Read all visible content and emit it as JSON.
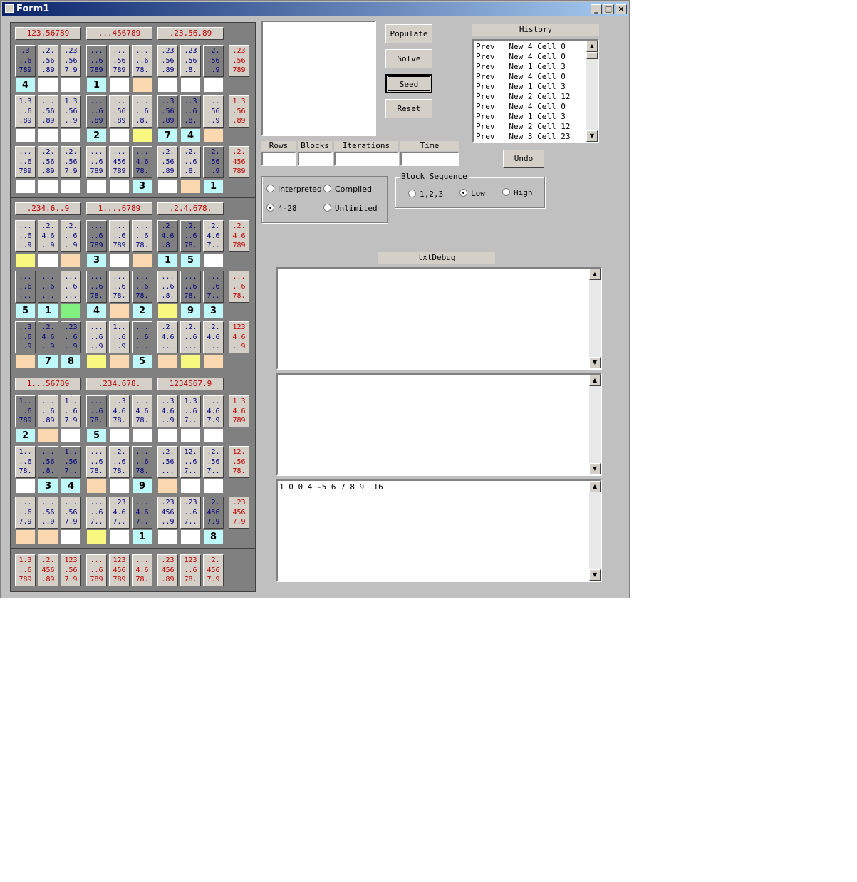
{
  "window": {
    "title": "Form1",
    "minimize": "_",
    "maximize": "□",
    "close": "×"
  },
  "blocks": [
    {
      "label": "123.56789"
    },
    {
      "label": "...456789"
    },
    {
      "label": ".23.56.89"
    },
    {
      "label": ".234.6..9"
    },
    {
      "label": "1....6789"
    },
    {
      "label": ".2.4.678."
    },
    {
      "label": "1...56789"
    },
    {
      "label": ".234.678."
    },
    {
      "label": "1234567.9"
    }
  ],
  "rows": [
    {
      "cands": [
        [
          ".3",
          "..6",
          "789"
        ],
        [
          ".2.",
          ".56",
          ".89"
        ],
        [
          ".23",
          ".56",
          "7.9"
        ],
        [
          "...",
          "..6",
          "789"
        ],
        [
          "...",
          ".56",
          "789"
        ],
        [
          "...",
          "..6",
          "78."
        ],
        [
          ".23",
          ".56",
          ".89"
        ],
        [
          ".23",
          ".56",
          ".8."
        ],
        [
          ".2.",
          ".56",
          "..9"
        ]
      ],
      "dark": [
        1,
        0,
        0,
        1,
        0,
        0,
        0,
        0,
        1
      ],
      "cells": [
        [
          "4",
          "c"
        ],
        [
          "",
          ""
        ],
        [
          "",
          ""
        ],
        [
          "1",
          "c"
        ],
        [
          "",
          ""
        ],
        [
          "",
          "o"
        ],
        [
          "",
          ""
        ],
        [
          "",
          ""
        ],
        [
          "",
          ""
        ]
      ],
      "side": [
        ".23",
        ".56",
        "789"
      ]
    },
    {
      "cands": [
        [
          "1.3",
          "..6",
          ".89"
        ],
        [
          "...",
          ".56",
          ".89"
        ],
        [
          "1.3",
          ".56",
          "..9"
        ],
        [
          "...",
          "..6",
          ".89"
        ],
        [
          "...",
          ".56",
          ".89"
        ],
        [
          "...",
          "..6",
          ".8."
        ],
        [
          "..3",
          ".56",
          ".89"
        ],
        [
          "..3",
          "..6",
          ".8."
        ],
        [
          "...",
          ".56",
          "..9"
        ]
      ],
      "dark": [
        0,
        0,
        0,
        1,
        0,
        0,
        1,
        1,
        0
      ],
      "cells": [
        [
          "",
          ""
        ],
        [
          "",
          ""
        ],
        [
          "",
          ""
        ],
        [
          "2",
          "c"
        ],
        [
          "",
          ""
        ],
        [
          "",
          "y"
        ],
        [
          "7",
          "c"
        ],
        [
          "4",
          "c"
        ],
        [
          "",
          "o"
        ]
      ],
      "side": [
        "1.3",
        ".56",
        ".89"
      ]
    },
    {
      "cands": [
        [
          "...",
          "..6",
          "789"
        ],
        [
          ".2.",
          ".56",
          ".89"
        ],
        [
          ".2.",
          ".56",
          "7.9"
        ],
        [
          "...",
          "..6",
          "789"
        ],
        [
          "...",
          "456",
          "789"
        ],
        [
          "...",
          "4.6",
          "78."
        ],
        [
          ".2.",
          ".56",
          ".89"
        ],
        [
          ".2.",
          "..6",
          ".8."
        ],
        [
          ".2.",
          ".56",
          "..9"
        ]
      ],
      "dark": [
        0,
        0,
        0,
        0,
        0,
        1,
        0,
        0,
        1
      ],
      "cells": [
        [
          "",
          ""
        ],
        [
          "",
          ""
        ],
        [
          "",
          ""
        ],
        [
          "",
          ""
        ],
        [
          "",
          ""
        ],
        [
          "3",
          "c"
        ],
        [
          "",
          ""
        ],
        [
          "",
          "o"
        ],
        [
          "1",
          "c"
        ]
      ],
      "side": [
        ".2.",
        "456",
        "789"
      ]
    },
    {
      "cands": [
        [
          "...",
          "..6",
          "..9"
        ],
        [
          ".2.",
          "4.6",
          "..9"
        ],
        [
          ".2.",
          "..6",
          "..9"
        ],
        [
          "...",
          "..6",
          "789"
        ],
        [
          "...",
          "..6",
          "789"
        ],
        [
          "...",
          "..6",
          "78."
        ],
        [
          ".2.",
          "4.6",
          ".8."
        ],
        [
          ".2.",
          "..6",
          "78."
        ],
        [
          ".2.",
          "4.6",
          "7.."
        ]
      ],
      "dark": [
        0,
        0,
        0,
        1,
        0,
        0,
        1,
        1,
        0
      ],
      "cells": [
        [
          "",
          "y"
        ],
        [
          "",
          ""
        ],
        [
          "",
          "o"
        ],
        [
          "3",
          "c"
        ],
        [
          "",
          ""
        ],
        [
          "",
          "o"
        ],
        [
          "1",
          "c"
        ],
        [
          "5",
          "c"
        ],
        [
          "",
          ""
        ]
      ],
      "side": [
        ".2.",
        "4.6",
        "789"
      ]
    },
    {
      "cands": [
        [
          "...",
          "..6",
          "..."
        ],
        [
          "...",
          "..6",
          "..."
        ],
        [
          "...",
          "..6",
          "..."
        ],
        [
          "...",
          "..6",
          "78."
        ],
        [
          "...",
          "..6",
          "78."
        ],
        [
          "...",
          "..6",
          "78."
        ],
        [
          "...",
          "..6",
          ".8."
        ],
        [
          "...",
          "..6",
          "78."
        ],
        [
          "...",
          "..6",
          "7.."
        ]
      ],
      "dark": [
        1,
        1,
        0,
        1,
        0,
        1,
        0,
        1,
        1
      ],
      "cells": [
        [
          "5",
          "c"
        ],
        [
          "1",
          "c"
        ],
        [
          "",
          "g"
        ],
        [
          "4",
          "c"
        ],
        [
          "",
          "o"
        ],
        [
          "2",
          "c"
        ],
        [
          "",
          "y"
        ],
        [
          "9",
          "c"
        ],
        [
          "3",
          "c"
        ]
      ],
      "side": [
        "...",
        "..6",
        "78."
      ]
    },
    {
      "cands": [
        [
          "..3",
          "..6",
          "..9"
        ],
        [
          ".2.",
          "4.6",
          "..9"
        ],
        [
          ".23",
          "..6",
          "..9"
        ],
        [
          "...",
          "..6",
          "..9"
        ],
        [
          "1..",
          "..6",
          "..9"
        ],
        [
          "...",
          "..6",
          "..."
        ],
        [
          ".2.",
          "4.6",
          "..."
        ],
        [
          ".2.",
          "..6",
          "..."
        ],
        [
          ".2.",
          "4.6",
          "..."
        ]
      ],
      "dark": [
        1,
        1,
        1,
        0,
        0,
        1,
        0,
        0,
        0
      ],
      "cells": [
        [
          "",
          "o"
        ],
        [
          "7",
          "c"
        ],
        [
          "8",
          "c"
        ],
        [
          "",
          "y"
        ],
        [
          "",
          "o"
        ],
        [
          "5",
          "c"
        ],
        [
          "",
          "o"
        ],
        [
          "",
          "y"
        ],
        [
          "",
          "o"
        ]
      ],
      "side": [
        "123",
        "4.6",
        "..9"
      ]
    },
    {
      "cands": [
        [
          "1..",
          "..6",
          "789"
        ],
        [
          "...",
          "..6",
          ".89"
        ],
        [
          "1..",
          "..6",
          "7.9"
        ],
        [
          "...",
          "..6",
          "78."
        ],
        [
          "..3",
          "4.6",
          "78."
        ],
        [
          "...",
          "4.6",
          "78."
        ],
        [
          "..3",
          "4.6",
          "..9"
        ],
        [
          "1.3",
          "..6",
          "7.."
        ],
        [
          "...",
          "4.6",
          "7.9"
        ]
      ],
      "dark": [
        1,
        0,
        0,
        1,
        0,
        0,
        0,
        0,
        0
      ],
      "cells": [
        [
          "2",
          "c"
        ],
        [
          "",
          "o"
        ],
        [
          "",
          ""
        ],
        [
          "5",
          "c"
        ],
        [
          "",
          ""
        ],
        [
          "",
          ""
        ],
        [
          "",
          ""
        ],
        [
          "",
          ""
        ],
        [
          "",
          ""
        ]
      ],
      "side": [
        "1.3",
        "4.6",
        "789"
      ]
    },
    {
      "cands": [
        [
          "1..",
          "..6",
          "78."
        ],
        [
          "...",
          ".56",
          ".8."
        ],
        [
          "1..",
          ".56",
          "7.."
        ],
        [
          "...",
          "..6",
          "78."
        ],
        [
          ".2.",
          "..6",
          "78."
        ],
        [
          "...",
          "..6",
          "78."
        ],
        [
          ".2.",
          ".56",
          "..."
        ],
        [
          "12.",
          "..6",
          "7.."
        ],
        [
          ".2.",
          ".56",
          "7.."
        ]
      ],
      "dark": [
        0,
        1,
        1,
        0,
        0,
        1,
        0,
        0,
        0
      ],
      "cells": [
        [
          "",
          ""
        ],
        [
          "3",
          "c"
        ],
        [
          "4",
          "c"
        ],
        [
          "",
          "o"
        ],
        [
          "",
          ""
        ],
        [
          "9",
          "c"
        ],
        [
          "",
          "o"
        ],
        [
          "",
          ""
        ],
        [
          "",
          ""
        ]
      ],
      "side": [
        "12.",
        ".56",
        "78."
      ]
    },
    {
      "cands": [
        [
          "...",
          "..6",
          "7.9"
        ],
        [
          "...",
          ".56",
          "..9"
        ],
        [
          "...",
          ".56",
          "7.9"
        ],
        [
          "...",
          "..6",
          "7.."
        ],
        [
          ".23",
          "4.6",
          "7.."
        ],
        [
          "...",
          "4.6",
          "7.."
        ],
        [
          ".23",
          "456",
          "..9"
        ],
        [
          ".23",
          "..6",
          "7.."
        ],
        [
          ".2.",
          "456",
          "7.9"
        ]
      ],
      "dark": [
        0,
        0,
        0,
        0,
        0,
        1,
        0,
        0,
        1
      ],
      "cells": [
        [
          "",
          "o"
        ],
        [
          "",
          "o"
        ],
        [
          "",
          ""
        ],
        [
          "",
          "y"
        ],
        [
          "",
          ""
        ],
        [
          "1",
          "c"
        ],
        [
          "",
          ""
        ],
        [
          "",
          ""
        ],
        [
          "8",
          "c"
        ]
      ],
      "side": [
        ".23",
        "456",
        "7.9"
      ]
    }
  ],
  "bottom": [
    [
      "1.3",
      "..6",
      "789"
    ],
    [
      ".2.",
      "456",
      ".89"
    ],
    [
      "123",
      ".56",
      "7.9"
    ],
    [
      "...",
      "..6",
      "789"
    ],
    [
      "123",
      "456",
      "789"
    ],
    [
      "...",
      "4.6",
      "78."
    ],
    [
      ".23",
      "456",
      ".89"
    ],
    [
      "123",
      "..6",
      "78."
    ],
    [
      ".2.",
      "456",
      "7.9"
    ]
  ],
  "buttons": {
    "populate": "Populate",
    "solve": "Solve",
    "seed": "Seed",
    "reset": "Reset",
    "undo": "Undo"
  },
  "stats": {
    "rows_label": "Rows",
    "blocks_label": "Blocks",
    "iterations_label": "Iterations",
    "time_label": "Time"
  },
  "mode": {
    "interpreted": "Interpreted",
    "compiled": "Compiled",
    "range": "4-28",
    "unlimited": "Unlimited"
  },
  "block_sequence": {
    "title": "Block Sequence",
    "opt1": "1,2,3",
    "opt2": "Low",
    "opt3": "High"
  },
  "history": {
    "title": "History",
    "items": [
      "Prev   New 4 Cell 0",
      "Prev   New 4 Cell 0",
      "Prev   New 1 Cell 3",
      "Prev   New 4 Cell 0",
      "Prev   New 1 Cell 3",
      "Prev   New 2 Cell 12",
      "Prev   New 4 Cell 0",
      "Prev   New 1 Cell 3",
      "Prev   New 2 Cell 12",
      "Prev   New 3 Cell 23"
    ]
  },
  "debug": {
    "label": "txtDebug",
    "text3": "1 0 0 4 -5 6 7 8 9  T6"
  }
}
